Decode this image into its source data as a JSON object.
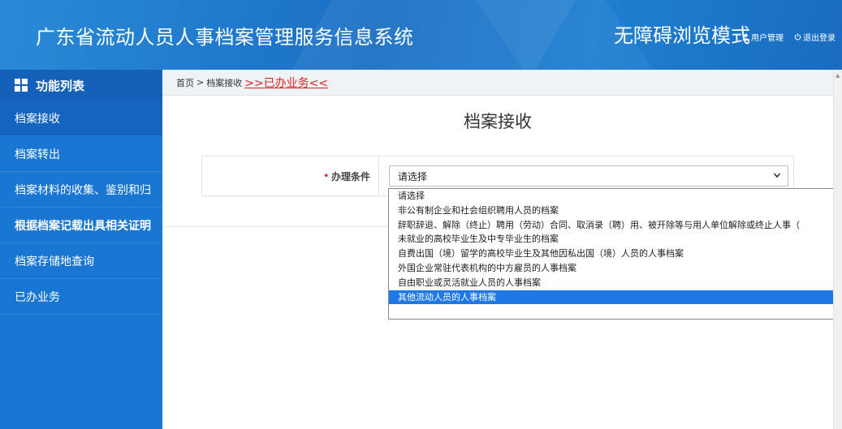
{
  "header": {
    "title": "广东省流动人员人事档案管理服务信息系统",
    "mode": "无障碍浏览模式",
    "user_mgmt": "用户管理",
    "logout": "退出登录",
    "user_icon": "user-icon",
    "power_icon": "power-icon"
  },
  "sidebar": {
    "heading": "功能列表",
    "items": [
      {
        "label": "档案接收"
      },
      {
        "label": "档案转出"
      },
      {
        "label": "档案材料的收集、鉴别和归"
      },
      {
        "label": "根据档案记载出具相关证明"
      },
      {
        "label": "档案存储地查询"
      },
      {
        "label": "已办业务"
      }
    ]
  },
  "breadcrumb": {
    "home": "首页",
    "separator": ">",
    "current": "档案接收",
    "done_link": ">>已办业务<<"
  },
  "main": {
    "page_title": "档案接收",
    "condition_label": "办理条件",
    "required_mark": "•",
    "select_value": "请选择"
  },
  "dropdown": {
    "options": [
      "请选择",
      "非公有制企业和社会组织聘用人员的档案",
      "辞职辞退、解除（终止）聘用（劳动）合同、取消录（聘）用、被开除等与用人单位解除或终止人事（",
      "未就业的高校毕业生及中专毕业生的档案",
      "自费出国（境）留学的高校毕业生及其他因私出国（境）人员的人事档案",
      "外国企业常驻代表机构的中方雇员的人事档案",
      "自由职业或灵活就业人员的人事档案",
      "其他流动人员的人事档案"
    ],
    "selected_index": 7
  },
  "colors": {
    "header_blue": "#1a6fc4",
    "sidebar_blue": "#1976d2",
    "highlight_blue": "#1e78e6",
    "link_red": "#e02020"
  }
}
